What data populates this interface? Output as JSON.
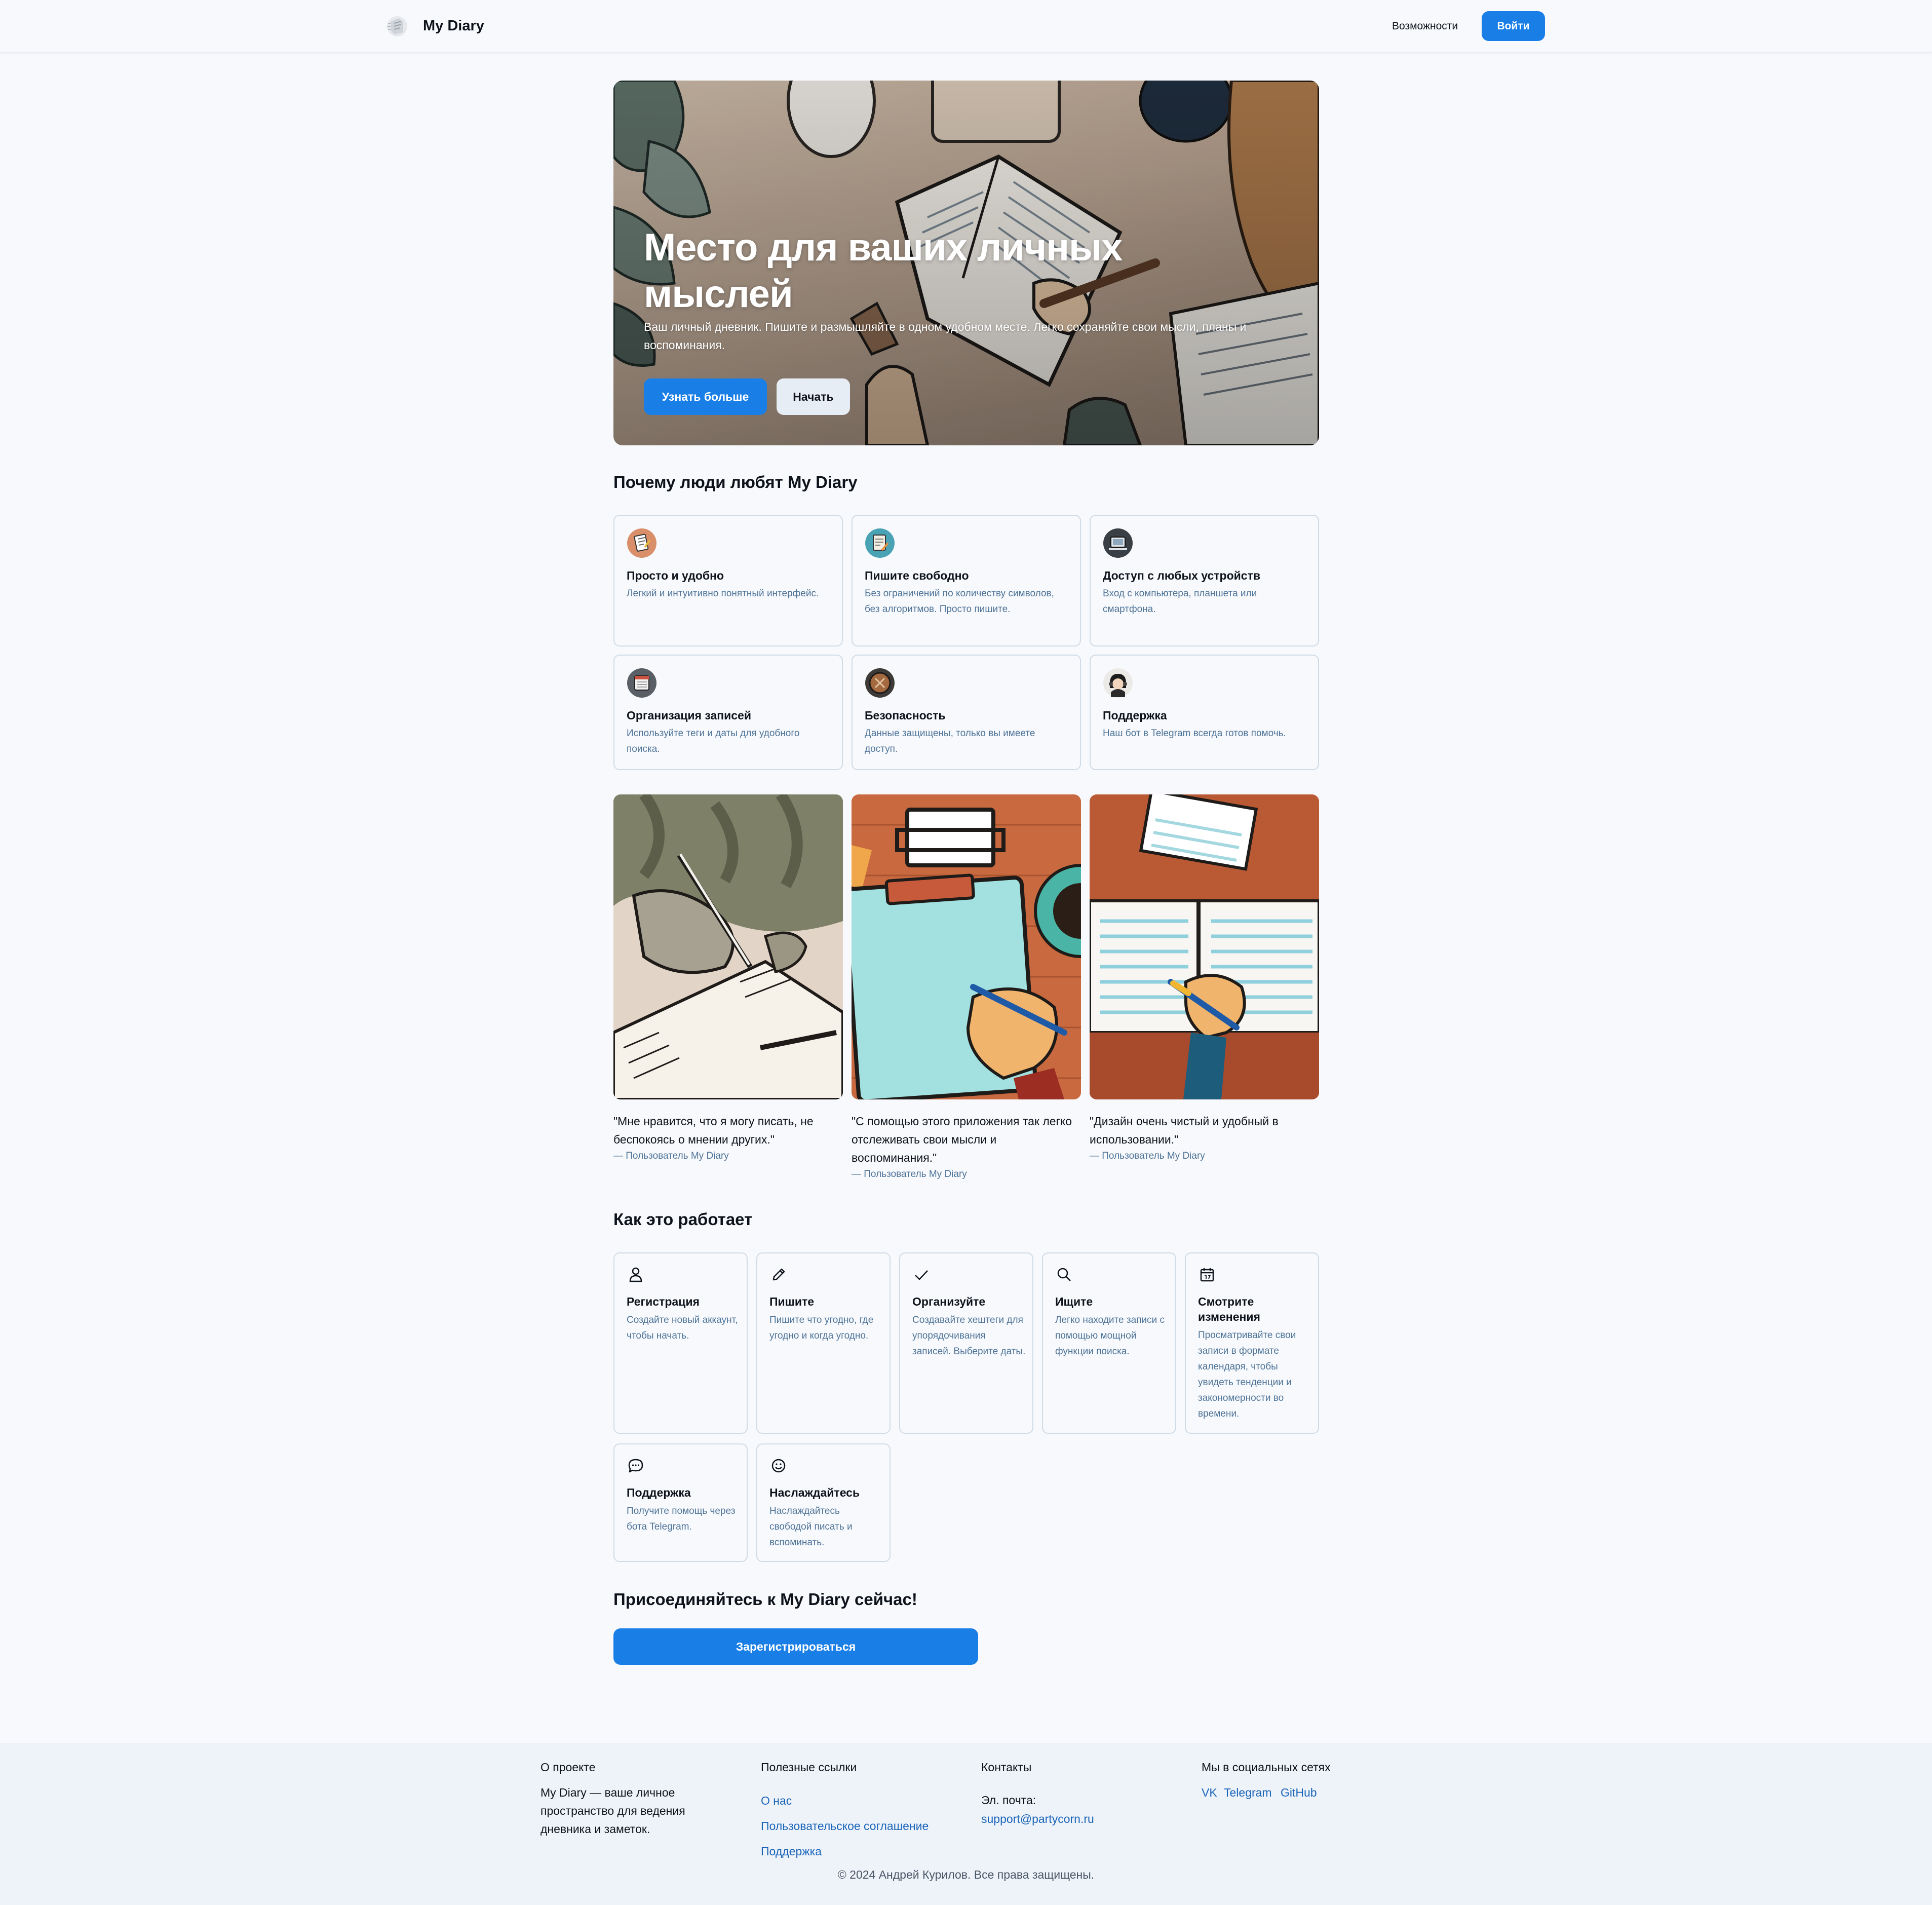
{
  "header": {
    "brand": "My Diary",
    "nav_features": "Возможности",
    "login": "Войти"
  },
  "hero": {
    "title": "Место для ваших личных мыслей",
    "subtitle": "Ваш личный дневник. Пишите и размышляйте в одном удобном месте. Легко сохраняйте свои мысли, планы и воспоминания.",
    "btn_learn_more": "Узнать больше",
    "btn_start": "Начать"
  },
  "features": {
    "title": "Почему люди любят My Diary",
    "items": [
      {
        "title": "Просто и удобно",
        "desc": "Легкий и интуитивно понятный интерфейс.",
        "icon": "notepad-icon"
      },
      {
        "title": "Пишите свободно",
        "desc": "Без ограничений по количеству символов, без алгоритмов. Просто пишите.",
        "icon": "writing-icon"
      },
      {
        "title": "Доступ с любых устройств",
        "desc": "Вход с компьютера, планшета или смартфона.",
        "icon": "devices-icon"
      },
      {
        "title": "Организация записей",
        "desc": "Используйте теги и даты для удобного поиска.",
        "icon": "calendar-icon"
      },
      {
        "title": "Безопасность",
        "desc": "Данные защищены, только вы имеете доступ.",
        "icon": "security-icon"
      },
      {
        "title": "Поддержка",
        "desc": "Наш бот в Telegram всегда готов помочь.",
        "icon": "support-agent-icon"
      }
    ]
  },
  "testimonials": [
    {
      "quote": "\"Мне нравится, что я могу писать, не беспокоясь о мнении других.\"",
      "author": "— Пользователь My Diary"
    },
    {
      "quote": "\"С помощью этого приложения так легко отслеживать свои мысли и воспоминания.\"",
      "author": "— Пользователь My Diary"
    },
    {
      "quote": "\"Дизайн очень чистый и удобный в использовании.\"",
      "author": "— Пользователь My Diary"
    }
  ],
  "how": {
    "title": "Как это работает",
    "steps": [
      {
        "title": "Регистрация",
        "desc": "Создайте новый аккаунт, чтобы начать.",
        "icon": "user-icon"
      },
      {
        "title": "Пишите",
        "desc": "Пишите что угодно, где угодно и когда угодно.",
        "icon": "pencil-icon"
      },
      {
        "title": "Организуйте",
        "desc": "Создавайте хештеги для упорядочивания записей. Выберите даты.",
        "icon": "check-icon"
      },
      {
        "title": "Ищите",
        "desc": "Легко находите записи с помощью мощной функции поиска.",
        "icon": "search-icon"
      },
      {
        "title": "Смотрите изменения",
        "desc": "Просматривайте свои записи в формате календаря, чтобы увидеть тенденции и закономерности во времени.",
        "icon": "calendar-icon"
      },
      {
        "title": "Поддержка",
        "desc": "Получите помощь через бота Telegram.",
        "icon": "chat-icon"
      },
      {
        "title": "Наслаждайтесь",
        "desc": "Наслаждайтесь свободой писать и вспоминать.",
        "icon": "smile-icon"
      }
    ]
  },
  "cta": {
    "title": "Присоединяйтесь к My Diary сейчас!",
    "button": "Зарегистрироваться"
  },
  "footer": {
    "about_title": "О проекте",
    "about_text": "My Diary — ваше личное пространство для ведения дневника и заметок.",
    "links_title": "Полезные ссылки",
    "links": [
      "О нас",
      "Пользовательское соглашение",
      "Поддержка"
    ],
    "contacts_title": "Контакты",
    "email_label": "Эл. почта:",
    "email": "support@partycorn.ru",
    "social_title": "Мы в социальных сетях",
    "social": [
      "VK",
      "Telegram",
      "GitHub"
    ],
    "copyright": "© 2024 Андрей Курилов. Все права защищены."
  },
  "colors": {
    "accent": "#197ee6",
    "muted_text": "#4e7397",
    "link": "#1a64b8",
    "border": "#d0dbe7"
  }
}
